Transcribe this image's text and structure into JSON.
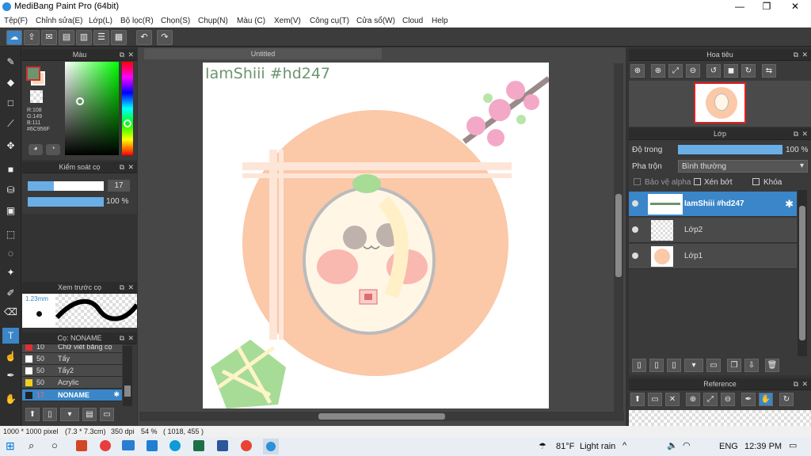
{
  "app": {
    "title": "MediBang Paint Pro (64bit)"
  },
  "menu": [
    "Tệp(F)",
    "Chỉnh sửa(E)",
    "Lớp(L)",
    "Bộ lọc(R)",
    "Chọn(S)",
    "Chụp(N)",
    "Màu (C)",
    "Xem(V)",
    "Công cụ(T)",
    "Cửa sổ(W)",
    "Cloud",
    "Help"
  ],
  "color_panel": {
    "title": "Màu",
    "r": "R:108",
    "g": "G:149",
    "b": "B:111",
    "hex": "#6C956F",
    "primary": "#6C956F",
    "secondary": "#f5d8b8"
  },
  "brush_control": {
    "title": "Kiểm soát cọ",
    "size": "17",
    "opacity": "100 %"
  },
  "brush_preview": {
    "title": "Xem trước cọ",
    "size": "1.23mm"
  },
  "brush_list": {
    "title": "Cọ: NONAME",
    "items": [
      {
        "num": "10",
        "name": "Chữ viết bằng cọ",
        "color": "#e03030"
      },
      {
        "num": "50",
        "name": "Tẩy",
        "color": "#ffffff"
      },
      {
        "num": "50",
        "name": "Tẩy2",
        "color": "#ffffff"
      },
      {
        "num": "50",
        "name": "Acrylic",
        "color": "#f0d020"
      },
      {
        "num": "17",
        "name": "NONAME",
        "color": "#222222"
      }
    ]
  },
  "canvas": {
    "tab": "Untitled",
    "overlay_text": "IamShiii #hd247"
  },
  "navigator": {
    "title": "Hoa tiêu"
  },
  "layer_panel": {
    "title": "Lớp",
    "opacity_label": "Độ trong",
    "opacity_value": "100 %",
    "blend_label": "Pha trộn",
    "blend_value": "Bình thường",
    "alpha_protect": "Bảo vệ alpha",
    "clipping": "Xén bớt",
    "lock": "Khóa",
    "layers": [
      {
        "name": "IamShiii #hd247"
      },
      {
        "name": "Lớp2"
      },
      {
        "name": "Lớp1"
      }
    ]
  },
  "reference": {
    "title": "Reference"
  },
  "status": {
    "size": "1000 * 1000 pixel",
    "cm": "(7.3 * 7.3cm)",
    "dpi": "350 dpi",
    "zoom": "54 %",
    "coords": "( 1018, 455 )"
  },
  "taskbar": {
    "temp": "81°F",
    "weather": "Light rain",
    "lang": "ENG",
    "time": "12:39 PM"
  }
}
